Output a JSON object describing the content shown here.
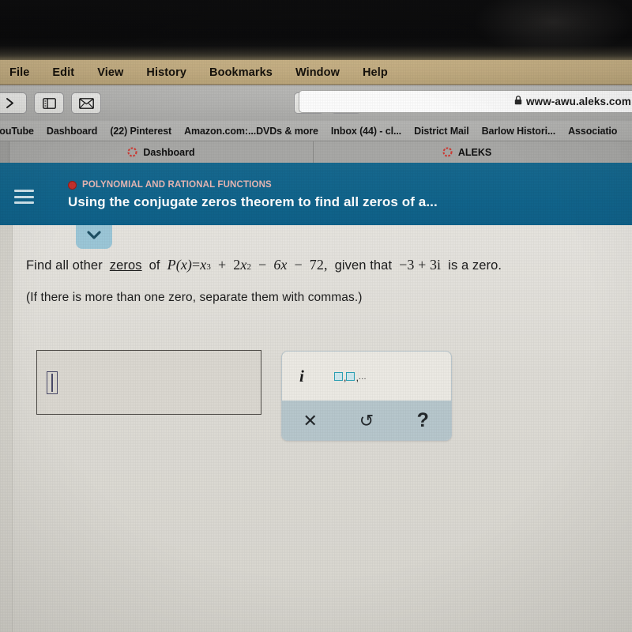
{
  "window": {
    "menu_items": [
      "File",
      "Edit",
      "View",
      "History",
      "Bookmarks",
      "Window",
      "Help"
    ]
  },
  "toolbar": {
    "forward_icon": "chevron-right-icon",
    "sidebar_icon": "sidebar-panel-icon",
    "mail_icon": "envelope-icon",
    "extension_icon": "hoopla-figure-icon",
    "privacy_icon": "privacy-shield-icon",
    "lock_icon": "lock-icon",
    "url": "www-awu.aleks.com"
  },
  "bookmarks": {
    "items": [
      "YouTube",
      "Dashboard",
      "(22) Pinterest",
      "Amazon.com:...DVDs & more",
      "Inbox (44) - cl...",
      "District Mail",
      "Barlow Histori...",
      "Associatio"
    ]
  },
  "tabs": {
    "items": [
      {
        "label": "Dashboard",
        "favicon": "aleks-logo-icon"
      },
      {
        "label": "ALEKS",
        "favicon": "aleks-logo-icon"
      }
    ]
  },
  "aleks_header": {
    "menu_icon": "hamburger-menu-icon",
    "topic_bullet_icon": "red-circle-icon",
    "topic": "POLYNOMIAL AND RATIONAL FUNCTIONS",
    "lesson_title": "Using the conjugate zeros theorem to find all zeros of a...",
    "background_color": "#12658c"
  },
  "collapse_tab": {
    "icon": "chevron-down-icon",
    "color": "#9cc7d8"
  },
  "question": {
    "line1": {
      "prefix": "Find all other",
      "link": "zeros",
      "mid": "of",
      "p_of_x": "P(x)",
      "equals": "=",
      "term1_base": "x",
      "term1_exp": "3",
      "plus1": "+",
      "term2_coef": "2",
      "term2_base": "x",
      "term2_exp": "2",
      "minus1": "−",
      "term3": "6x",
      "minus2": "−",
      "term4": "72,",
      "given": "given that",
      "zero_value": "−3 + 3i",
      "suffix": "is a zero."
    },
    "line2": "(If there is more than one zero, separate them with commas.)"
  },
  "answer": {
    "value": "",
    "placeholder_icon": "math-cursor-placeholder-icon"
  },
  "keypad": {
    "imaginary_label": "i",
    "list_label_boxes": [
      "□",
      "□"
    ],
    "list_comma": ",",
    "list_dots": "...",
    "clear_glyph": "✕",
    "undo_glyph": "↺",
    "help_glyph": "?",
    "accent_color": "#2ba3b8",
    "bottom_row_color": "#b7c7cd"
  }
}
